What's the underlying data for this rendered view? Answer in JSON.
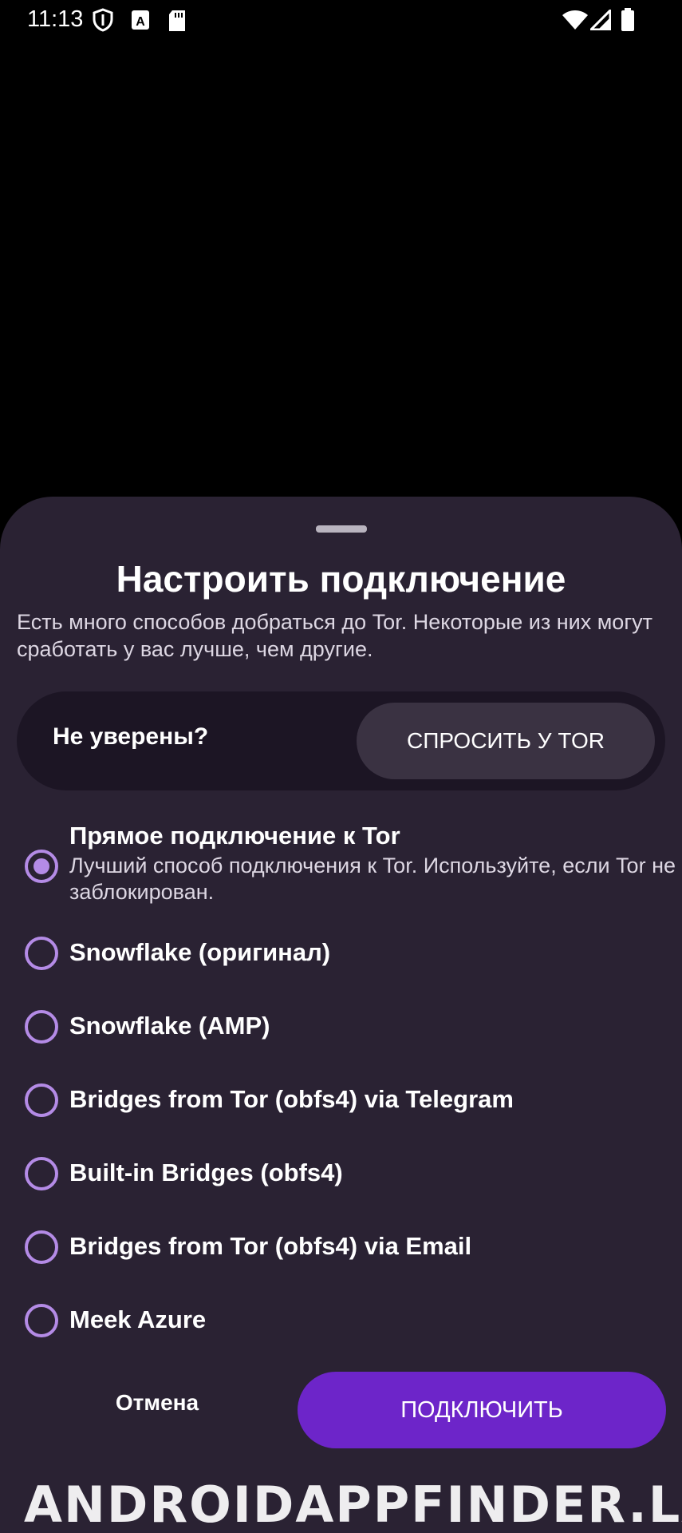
{
  "status_bar": {
    "time": "11:13",
    "left_icons": [
      "shield-icon",
      "a-notification-icon",
      "sd-card-icon"
    ],
    "right_icons": [
      "wifi-icon",
      "signal-icon",
      "battery-icon"
    ]
  },
  "sheet": {
    "title": "Настроить подключение",
    "description": "Есть много способов добраться до Tor. Некоторые из них могут сработать у вас лучше, чем другие.",
    "unsure_label": "Не уверены?",
    "ask_button": "СПРОСИТЬ У TOR",
    "options": [
      {
        "title": "Прямое подключение к Tor",
        "subtitle": "Лучший способ подключения к Tor. Используйте, если Tor не заблокирован.",
        "selected": true
      },
      {
        "title": "Snowflake (оригинал)",
        "selected": false
      },
      {
        "title": "Snowflake (AMP)",
        "selected": false
      },
      {
        "title": "Bridges from Tor (obfs4) via Telegram",
        "selected": false
      },
      {
        "title": "Built-in Bridges (obfs4)",
        "selected": false
      },
      {
        "title": "Bridges from Tor (obfs4) via Email",
        "selected": false
      },
      {
        "title": "Meek Azure",
        "selected": false
      }
    ],
    "cancel_button": "Отмена",
    "connect_button": "ПОДКЛЮЧИТЬ"
  },
  "watermark": "ANDROIDAPPFINDER.LAT",
  "colors": {
    "sheet_bg": "#2a2233",
    "accent": "#6d25c9",
    "radio": "#b48be6"
  }
}
